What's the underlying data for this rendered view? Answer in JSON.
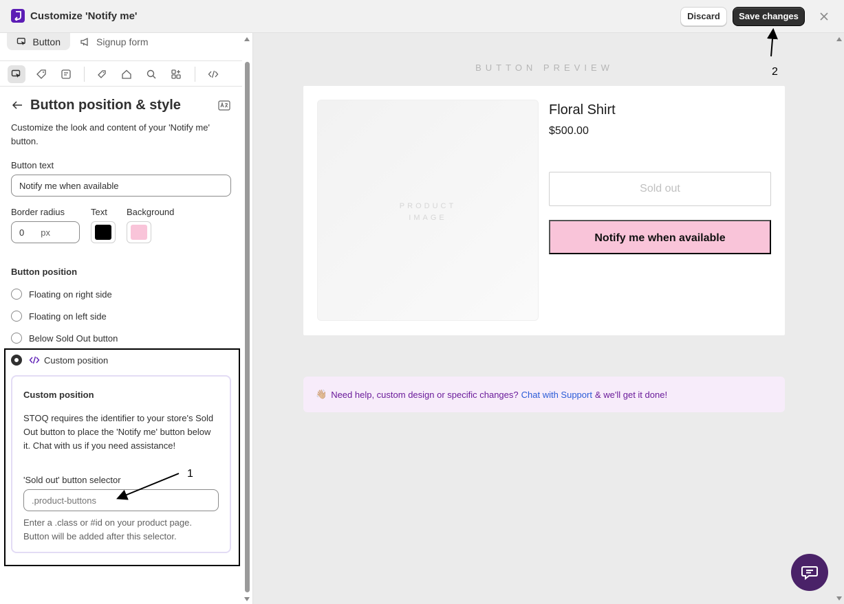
{
  "header": {
    "title": "Customize 'Notify me'",
    "discard_label": "Discard",
    "save_label": "Save changes"
  },
  "sidebar": {
    "tabs": [
      {
        "label": "Button",
        "icon": "cursor-click-icon",
        "active": true
      },
      {
        "label": "Signup form",
        "icon": "megaphone-icon",
        "active": false
      }
    ],
    "icon_bar": [
      "cursor-click-icon",
      "tag-icon",
      "note-icon",
      "price-tag-icon",
      "home-icon",
      "search-icon",
      "apps-icon",
      "code-icon"
    ],
    "panel_title": "Button position & style",
    "panel_description": "Customize the look and content of your 'Notify me' button.",
    "button_text_label": "Button text",
    "button_text_value": "Notify me when available",
    "border_radius_label": "Border radius",
    "border_radius_value": "0",
    "border_radius_unit": "px",
    "text_color_label": "Text",
    "text_color": "#000000",
    "background_label": "Background",
    "background_color": "#f9c4d9",
    "position_title": "Button position",
    "position_options": [
      {
        "label": "Floating on right side",
        "checked": false
      },
      {
        "label": "Floating on left side",
        "checked": false
      },
      {
        "label": "Below Sold Out button",
        "checked": false
      },
      {
        "label": "Custom position",
        "checked": true
      }
    ],
    "custom_card": {
      "title": "Custom position",
      "body": "STOQ requires the identifier to your store's Sold Out button to place the 'Notify me' button below it. Chat with us if you need assistance!",
      "selector_label": "'Sold out' button selector",
      "selector_placeholder": ".product-buttons",
      "help": "Enter a .class or #id on your product page. Button will be added after this selector."
    }
  },
  "preview": {
    "label": "BUTTON PREVIEW",
    "product_name": "Floral Shirt",
    "product_price": "$500.00",
    "image_placeholder_line1": "PRODUCT",
    "image_placeholder_line2": "IMAGE",
    "soldout_label": "Sold out",
    "notify_label": "Notify me when available",
    "help_emoji": "👋🏼",
    "help_text_before": "Need help, custom design or specific changes?",
    "help_link": "Chat with Support",
    "help_text_after": "& we'll get it done!"
  },
  "annotations": {
    "one": "1",
    "two": "2"
  },
  "colors": {
    "accent": "#5c1db5",
    "primary_button": "#303030",
    "chat_fab": "#4a2268"
  }
}
